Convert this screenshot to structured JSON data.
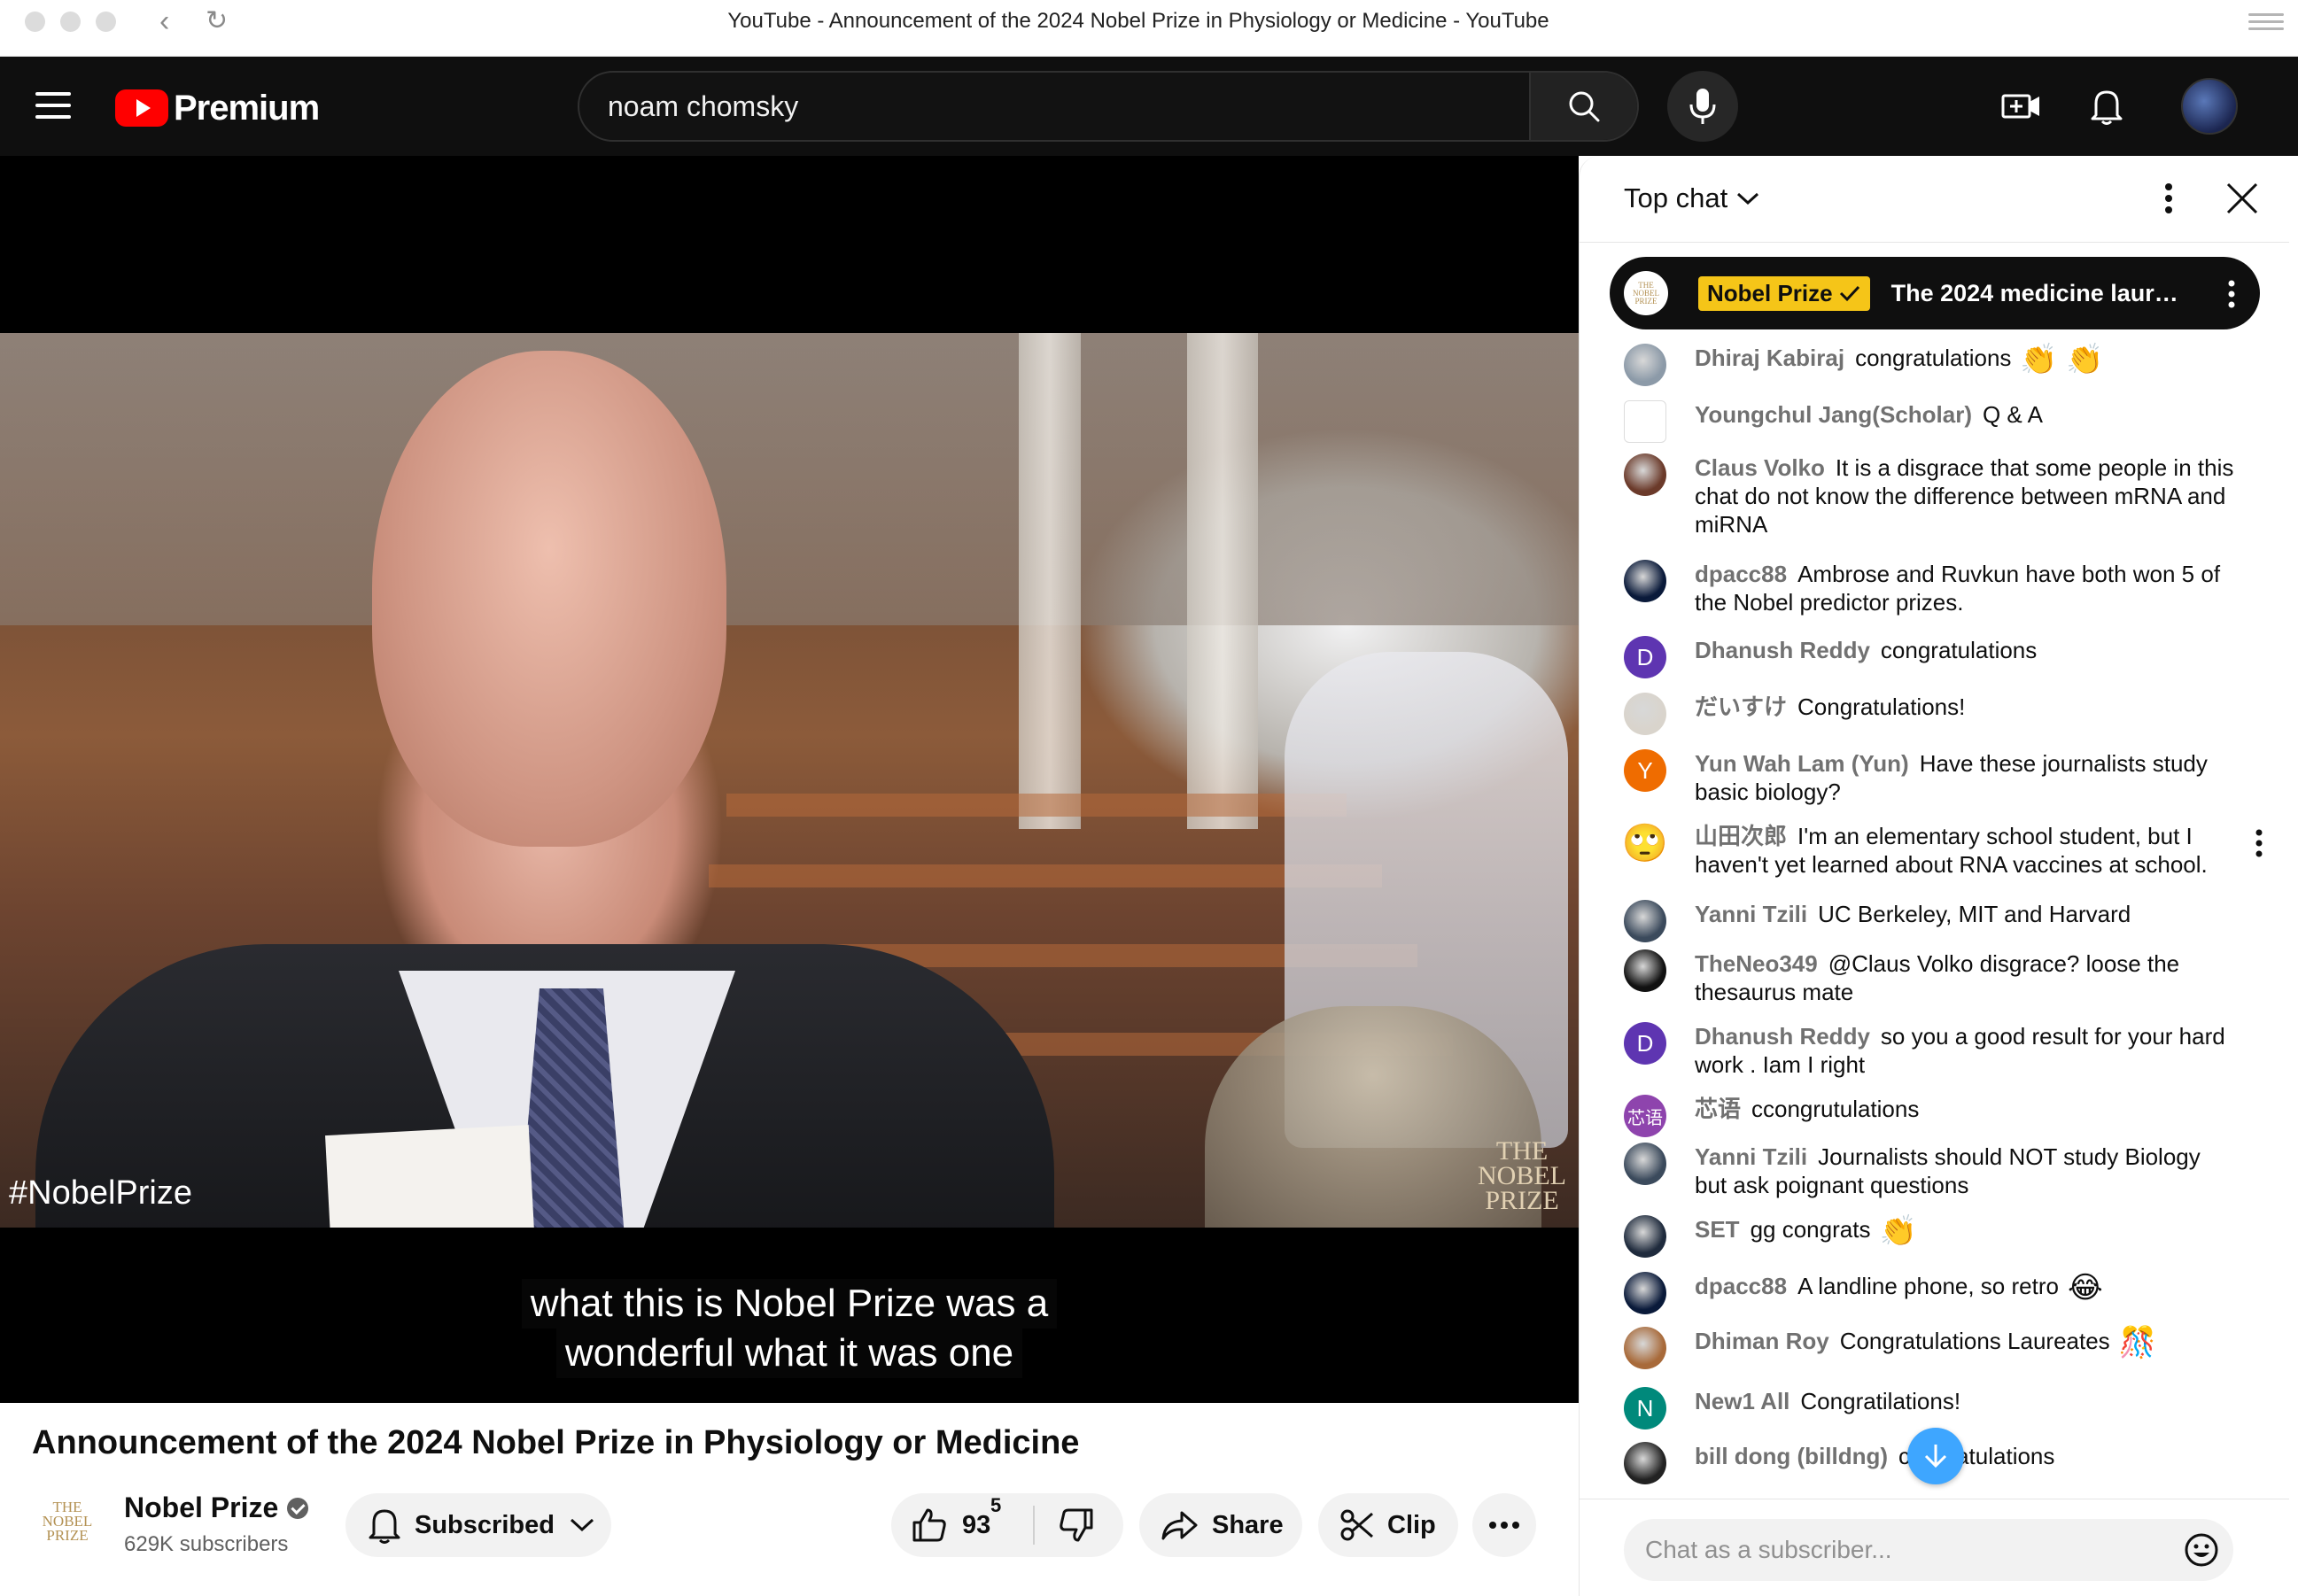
{
  "window": {
    "title": "YouTube - Announcement of the 2024 Nobel Prize in Physiology or Medicine - YouTube",
    "back_icon": "‹",
    "reload_icon": "↻"
  },
  "header": {
    "logo_text": "Premium",
    "search": {
      "value": "noam chomsky",
      "placeholder": "Search"
    },
    "icons": [
      "menu-icon",
      "search-icon",
      "mic-icon",
      "create-icon",
      "notifications-icon",
      "avatar"
    ],
    "brand_color": "#ff0000"
  },
  "video": {
    "hashtag": "#NobelPrize",
    "watermark": [
      "THE",
      "NOBEL",
      "PRIZE"
    ],
    "caption_lines": [
      "what this is Nobel Prize was a",
      "wonderful what it was one"
    ],
    "title": "Announcement of the 2024 Nobel Prize in Physiology or Medicine"
  },
  "channel": {
    "logo_lines": [
      "THE",
      "NOBEL",
      "PRIZE"
    ],
    "name": "Nobel Prize",
    "subscribers": "629K subscribers",
    "subscribed_label": "Subscribed"
  },
  "actions": {
    "likes": "93",
    "likes_sup": "5",
    "share_label": "Share",
    "clip_label": "Clip"
  },
  "chat": {
    "mode_label": "Top chat",
    "pinned": {
      "avatar_lines": [
        "THE",
        "NOBEL",
        "PRIZE"
      ],
      "author": "Nobel Prize",
      "message": "The 2024 medicine laur…"
    },
    "messages": [
      {
        "author": "Dhiraj Kabiraj",
        "text": "congratulations",
        "emoji": "👏 👏",
        "avatar": "photo",
        "avatar_color": "#8c9aa8"
      },
      {
        "author": "Youngchul Jang(Scholar)",
        "text": "Q & A",
        "emoji": "",
        "avatar": "icon",
        "avatar_color": "#ffffff"
      },
      {
        "author": "Claus Volko",
        "text": "It is a disgrace that some people in this chat do not know the difference between mRNA and miRNA",
        "emoji": "",
        "avatar": "photo",
        "avatar_color": "#6b3a2a"
      },
      {
        "author": "dpacc88",
        "text": "Ambrose and Ruvkun have both won 5 of the Nobel predictor prizes.",
        "emoji": "",
        "avatar": "photo",
        "avatar_color": "#0a1a3a"
      },
      {
        "author": "Dhanush Reddy",
        "text": "congratulations",
        "emoji": "",
        "avatar": "D",
        "avatar_color": "#5e35b1"
      },
      {
        "author": "だいすけ",
        "text": "Congratulations!",
        "emoji": "",
        "avatar": "photo",
        "avatar_color": "#d9d4cc"
      },
      {
        "author": "Yun Wah Lam (Yun)",
        "text": "Have these journalists study basic biology?",
        "emoji": "",
        "avatar": "Y",
        "avatar_color": "#ef6c00"
      },
      {
        "author": "山田次郎",
        "text": "I'm an elementary school student, but I haven't yet learned about RNA vaccines at school.",
        "emoji": "",
        "avatar": "🙄",
        "avatar_color": "#ffffff"
      },
      {
        "author": "Yanni Tzili",
        "text": "UC Berkeley, MIT and Harvard",
        "emoji": "",
        "avatar": "photo",
        "avatar_color": "#3b4a5c"
      },
      {
        "author": "TheNeo349",
        "text": "@Claus Volko disgrace? loose the thesaurus mate",
        "emoji": "",
        "avatar": "photo",
        "avatar_color": "#111111"
      },
      {
        "author": "Dhanush Reddy",
        "text": "so you a good result for your hard work . Iam I right",
        "emoji": "",
        "avatar": "D",
        "avatar_color": "#5e35b1"
      },
      {
        "author": "芯语",
        "text": "ccongrutulations",
        "emoji": "",
        "avatar": "芯语",
        "avatar_color": "#8e44ad"
      },
      {
        "author": "Yanni Tzili",
        "text": "Journalists should NOT study Biology but ask poignant questions",
        "emoji": "",
        "avatar": "photo",
        "avatar_color": "#3b4a5c"
      },
      {
        "author": "SET",
        "text": "gg congrats",
        "emoji": "👏",
        "avatar": "photo",
        "avatar_color": "#1f2b3d"
      },
      {
        "author": "dpacc88",
        "text": "A landline phone, so retro",
        "emoji": "😂",
        "avatar": "photo",
        "avatar_color": "#0a1a3a"
      },
      {
        "author": "Dhiman Roy",
        "text": "Congratulations Laureates",
        "emoji": "🎊",
        "avatar": "photo",
        "avatar_color": "#a86a3a"
      },
      {
        "author": "New1 All",
        "text": "Congratilations!",
        "emoji": "",
        "avatar": "N",
        "avatar_color": "#00897b"
      },
      {
        "author": "bill dong (billdng)",
        "text": "congratulations",
        "emoji": "",
        "avatar": "photo",
        "avatar_color": "#222222"
      }
    ],
    "input_placeholder": "Chat as a subscriber..."
  }
}
